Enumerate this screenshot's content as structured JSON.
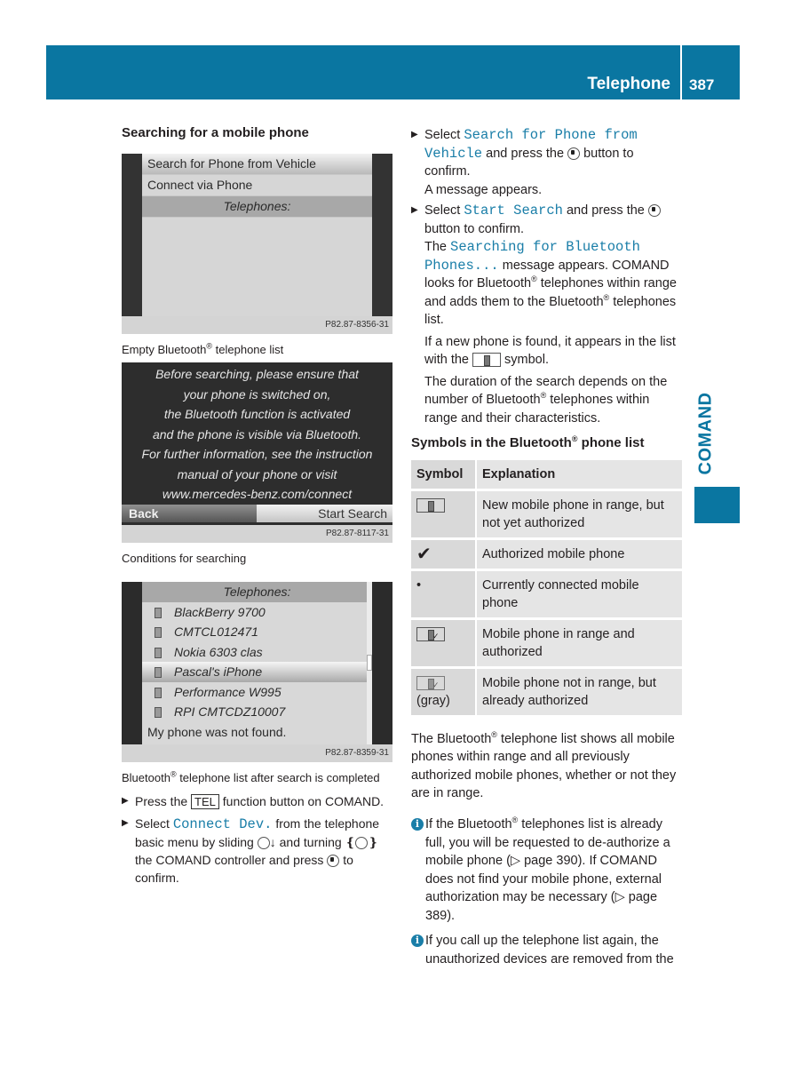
{
  "header": {
    "section": "Telephone",
    "page": "387"
  },
  "side_tab": {
    "label": "COMAND"
  },
  "left": {
    "heading": "Searching for a mobile phone",
    "screen1": {
      "items": [
        "Search for Phone from Vehicle",
        "Connect via Phone",
        "Telephones:"
      ],
      "ref": "P82.87-8356-31"
    },
    "caption1_pre": "Empty Bluetooth",
    "caption1_post": " telephone list",
    "screen2": {
      "message_lines": [
        "Before searching, please ensure that",
        "your phone is switched on,",
        "the Bluetooth function is activated",
        "and the phone is visible via Bluetooth.",
        "For further information, see the instruction",
        "manual of your phone or visit",
        "www.mercedes-benz.com/connect"
      ],
      "back": "Back",
      "start": "Start Search",
      "ref": "P82.87-8117-31"
    },
    "caption2": "Conditions for searching",
    "screen3": {
      "header": "Telephones:",
      "phones": [
        "BlackBerry 9700",
        "CMTCL012471",
        "Nokia 6303 clas",
        "Pascal's iPhone",
        "Performance W995",
        "RPI CMTCDZ10007"
      ],
      "not_found": "My phone was not found.",
      "ref": "P82.87-8359-31"
    },
    "caption3_pre": "Bluetooth",
    "caption3_post": " telephone list after search is completed",
    "steps": {
      "s1_a": "Press the ",
      "s1_key": "TEL",
      "s1_b": " function button on COMAND.",
      "s2_a": "Select ",
      "s2_code": "Connect Dev.",
      "s2_b": " from the telephone basic menu by sliding ",
      "s2_c": " and turning ",
      "s2_d": " the COMAND controller and press ",
      "s2_e": " to confirm."
    }
  },
  "right": {
    "s3_a": "Select ",
    "s3_code": "Search for Phone from Vehicle",
    "s3_b": " and press the ",
    "s3_c": " button to confirm.",
    "s3_result": "A message appears.",
    "s4_a": "Select ",
    "s4_code": "Start Search",
    "s4_b": " and press the ",
    "s4_c": " button to confirm.",
    "s4_r1": "The ",
    "s4_r_code": "Searching for Bluetooth Phones...",
    "s4_r2": " message appears. COMAND looks for Bluetooth",
    "s4_r3": " telephones within range and adds them to the Bluetooth",
    "s4_r4": " telephones list.",
    "p1_a": "If a new phone is found, it appears in the list with the ",
    "p1_b": " symbol.",
    "p2_a": "The duration of the search depends on the number of Bluetooth",
    "p2_b": " telephones within range and their characteristics.",
    "table_heading_a": "Symbols in the Bluetooth",
    "table_heading_b": " phone list",
    "table": {
      "col_symbol": "Symbol",
      "col_expl": "Explanation",
      "rows": [
        {
          "symbol": "phone-icon",
          "explanation": "New mobile phone in range, but not yet authorized"
        },
        {
          "symbol": "checkmark-icon",
          "explanation": "Authorized mobile phone"
        },
        {
          "symbol": "dot-icon",
          "explanation": "Currently connected mobile phone"
        },
        {
          "symbol": "phone-check-icon",
          "explanation": "Mobile phone in range and authorized"
        },
        {
          "symbol": "phone-check-icon-gray",
          "note": "(gray)",
          "explanation": "Mobile phone not in range, but already authorized"
        }
      ]
    },
    "p3_a": "The Bluetooth",
    "p3_b": " telephone list shows all mobile phones within range and all previously authorized mobile phones, whether or not they are in range.",
    "info1_a": "If the Bluetooth",
    "info1_b": " telephones list is already full, you will be requested to de-authorize a mobile phone (▷ page 390). If COMAND does not find your mobile phone, external authorization may be necessary (▷ page 389).",
    "info2": "If you call up the telephone list again, the unauthorized devices are removed from the",
    "reg": "®"
  }
}
